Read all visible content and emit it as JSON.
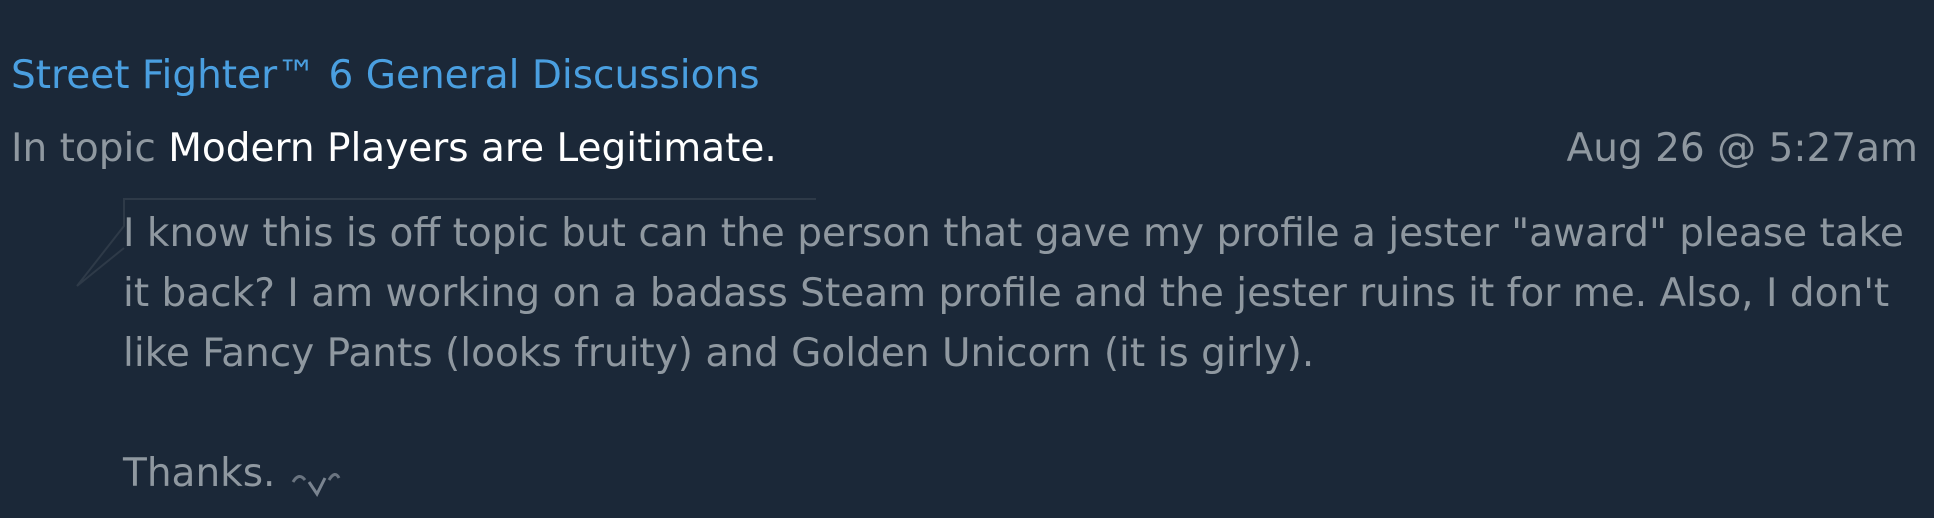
{
  "forum": {
    "title": "Street Fighter™ 6 General Discussions"
  },
  "topic": {
    "prefix": "In topic",
    "title": "Modern Players are Legitimate.",
    "timestamp": "Aug 26 @ 5:27am"
  },
  "post": {
    "lines": [
      "I know this is off topic but can the person that gave my profile a jester \"award\" please take",
      "it back? I am working on a badass Steam profile and the jester ruins it for me. Also, I don't",
      "like Fancy Pants (looks fruity) and Golden Unicorn (it is girly)."
    ],
    "closing": "Thanks.",
    "emoticon_icon": "emoticon-icon"
  },
  "colors": {
    "background": "#1b2838",
    "link": "#4a9fe0",
    "muted_text": "#8f98a0",
    "highlight_text": "#ffffff"
  }
}
